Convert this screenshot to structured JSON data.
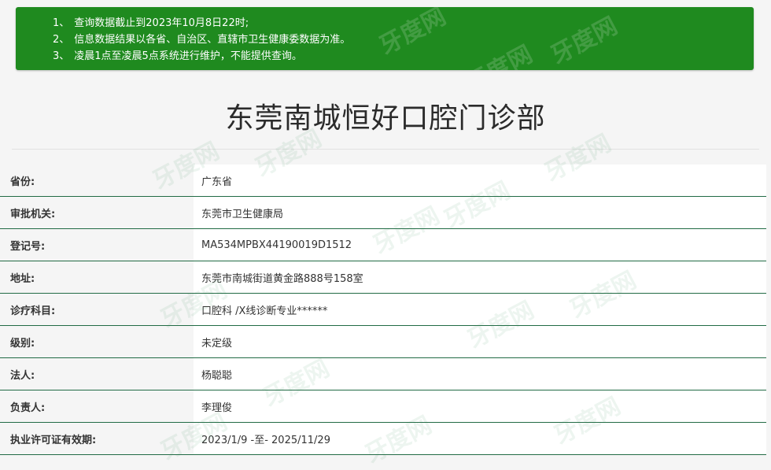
{
  "notice": {
    "items": [
      {
        "num": "1、",
        "text": "查询数据截止到2023年10月8日22时;"
      },
      {
        "num": "2、",
        "text": "信息数据结果以各省、自治区、直辖市卫生健康委数据为准。"
      },
      {
        "num": "3、",
        "text": "凌晨1点至凌晨5点系统进行维护，不能提供查询。"
      }
    ],
    "bg_color": "#1f8a1f"
  },
  "page_title": "东莞南城恒好口腔门诊部",
  "watermark": "牙度网",
  "info_rows": [
    {
      "label": "省份:",
      "value": "广东省"
    },
    {
      "label": "审批机关:",
      "value": "东莞市卫生健康局"
    },
    {
      "label": "登记号:",
      "value": "MA534MPBX44190019D1512"
    },
    {
      "label": "地址:",
      "value": "东莞市南城街道黄金路888号158室"
    },
    {
      "label": "诊疗科目:",
      "value": "口腔科 /X线诊断专业******"
    },
    {
      "label": "级别:",
      "value": "未定级"
    },
    {
      "label": "法人:",
      "value": "杨聪聪"
    },
    {
      "label": "负责人:",
      "value": "李理俊"
    },
    {
      "label": "执业许可证有效期:",
      "value": "2023/1/9 -至- 2025/11/29"
    }
  ],
  "colors": {
    "accent_green": "#1f8a1f",
    "row_border": "#226b45"
  }
}
